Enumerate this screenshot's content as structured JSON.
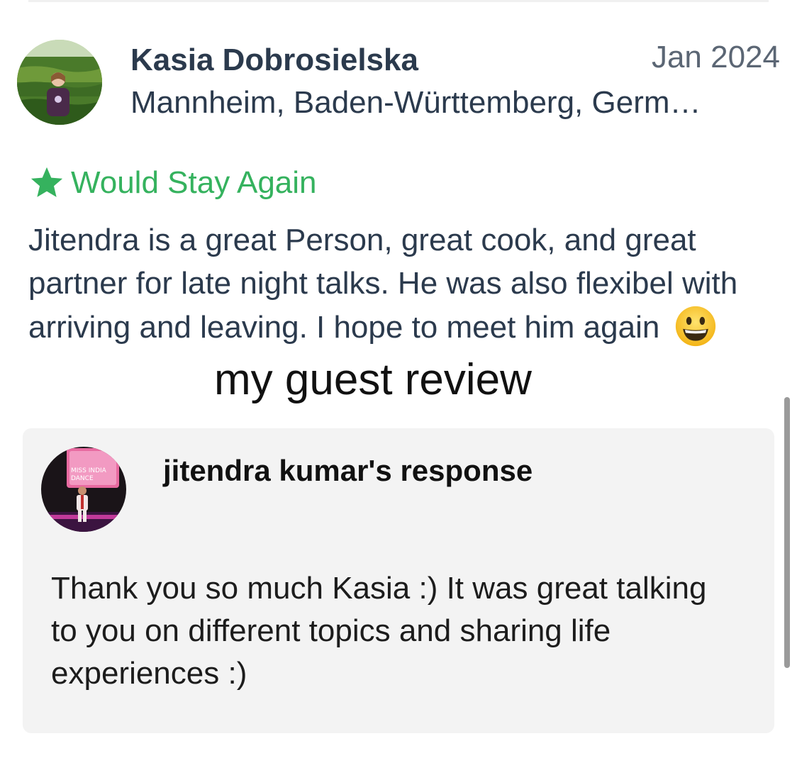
{
  "review": {
    "reviewer_name": "Kasia Dobrosielska",
    "date": "Jan 2024",
    "location": "Mannheim, Baden-Württemberg, Germ…",
    "badge_label": "Would Stay Again",
    "text": "Jitendra is a great Person, great cook, and great partner for late night talks. He was also flexibel with arriving and leaving. I hope to meet him again",
    "emoji_icon": "grinning-face-icon",
    "badge_color": "#35b25e"
  },
  "caption": "my guest review",
  "response": {
    "title": "jitendra kumar's response",
    "text": "Thank you so much Kasia :) It was great talking to you on different topics and sharing life experiences :)",
    "avatar_sign_text": "MISS INDIA\nDANCE"
  }
}
